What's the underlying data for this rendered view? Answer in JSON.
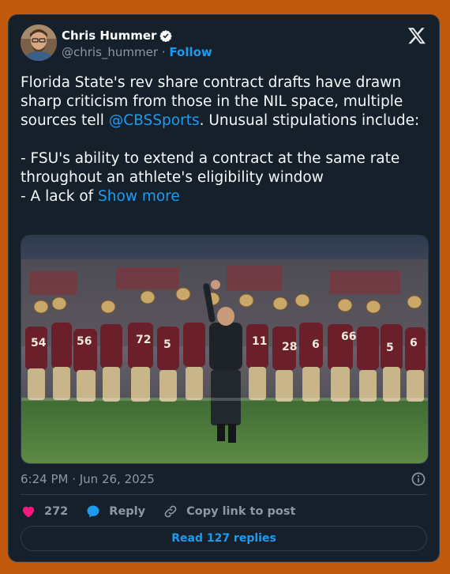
{
  "author": {
    "name": "Chris Hummer",
    "handle": "@chris_hummer",
    "separator": "·",
    "follow_label": "Follow"
  },
  "tweet": {
    "text_part1": "Florida State's rev share contract drafts have drawn sharp criticism from those in the NIL space, multiple sources tell ",
    "mention": "@CBSSports",
    "text_part2": ". Unusual stipulations include:\n\n- FSU's ability to extend a contract at the same rate throughout an athlete's eligibility window\n- A lack of ",
    "show_more": "Show more",
    "timestamp": "6:24 PM · Jun 26, 2025"
  },
  "actions": {
    "likes": "272",
    "reply_label": "Reply",
    "copy_label": "Copy link to post",
    "read_replies": "Read 127 replies"
  },
  "colors": {
    "background": "#c15a0c",
    "card": "#15202b",
    "accent": "#1d9bf0",
    "like": "#f91880"
  },
  "icons": [
    "verified-badge-icon",
    "x-logo-icon",
    "info-icon",
    "heart-icon",
    "reply-bubble-icon",
    "link-icon"
  ]
}
